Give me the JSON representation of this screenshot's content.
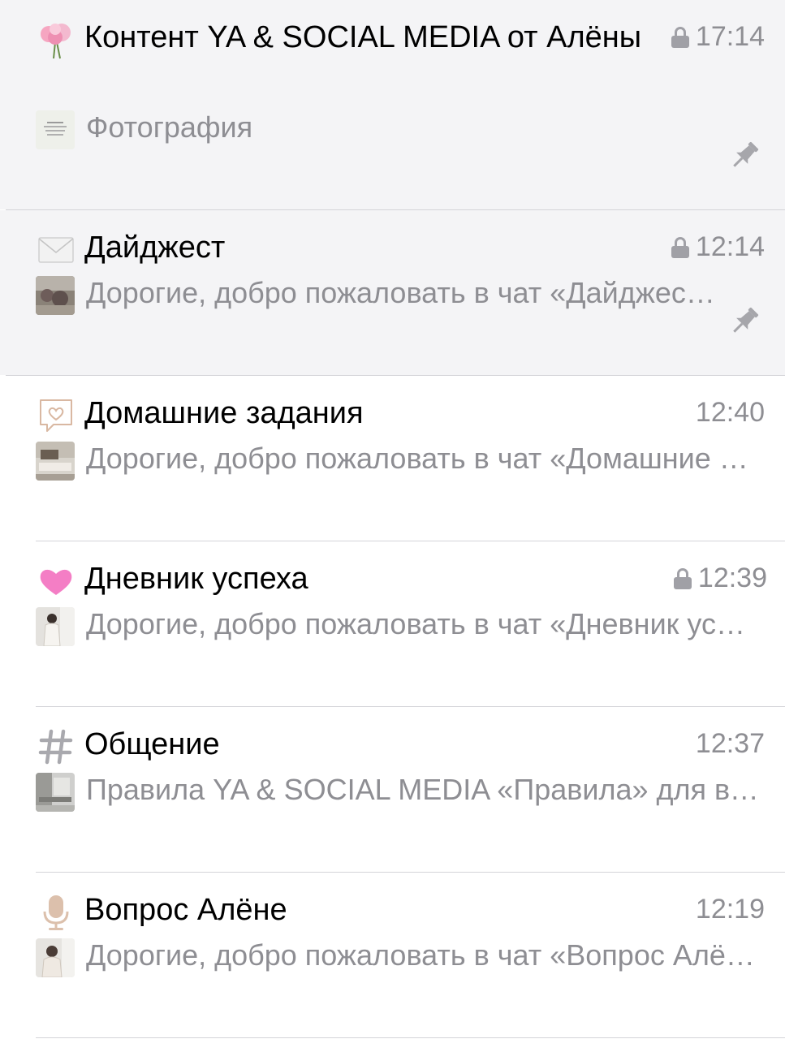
{
  "chats": [
    {
      "icon": "flower-emoji-icon",
      "title": "Контент YA & SOCIAL MEDIA от Алёны",
      "time": "17:14",
      "locked": true,
      "pinned": true,
      "preview": "Фотография"
    },
    {
      "icon": "envelope-emoji-icon",
      "title": "Дайджест",
      "time": "12:14",
      "locked": true,
      "pinned": true,
      "preview": "Дорогие, добро пожаловать в чат «Дайджест»"
    },
    {
      "icon": "heart-speech-bubble-icon",
      "title": "Домашние задания",
      "time": "12:40",
      "locked": false,
      "pinned": false,
      "preview": "Дорогие, добро пожаловать в чат «Домашние задания»"
    },
    {
      "icon": "pink-heart-icon",
      "title": "Дневник успеха",
      "time": "12:39",
      "locked": true,
      "pinned": false,
      "preview": "Дорогие, добро пожаловать в чат «Дневник успеха»"
    },
    {
      "icon": "hashtag-icon",
      "title": "Общение",
      "time": "12:37",
      "locked": false,
      "pinned": false,
      "preview": "Правила YA & SOCIAL MEDIA  «Правила» для всех"
    },
    {
      "icon": "microphone-icon",
      "title": "Вопрос Алёне",
      "time": "12:19",
      "locked": false,
      "pinned": false,
      "preview": "Дорогие, добро пожаловать в чат «Вопрос Алёне»"
    }
  ]
}
